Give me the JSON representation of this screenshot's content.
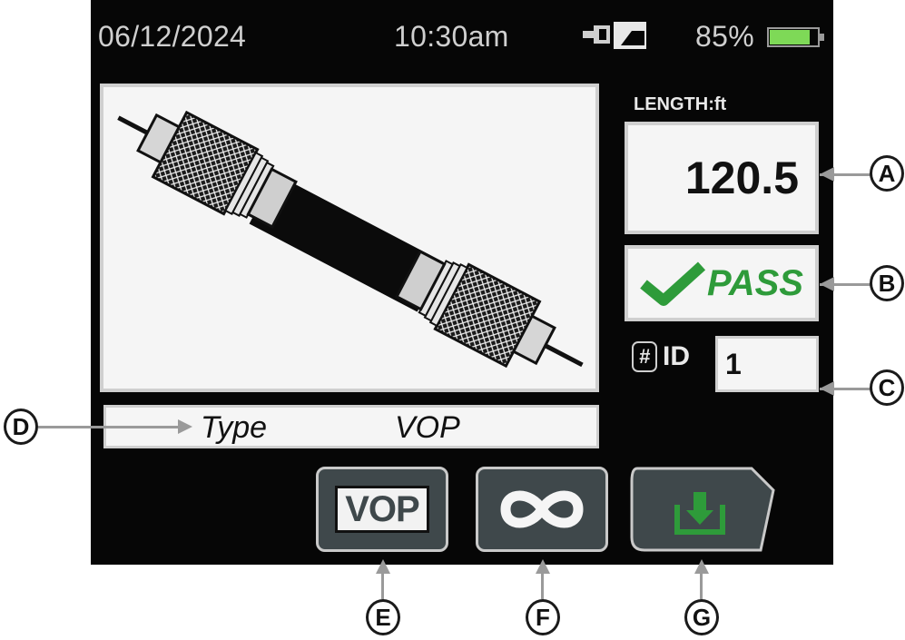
{
  "status_bar": {
    "date": "06/12/2024",
    "time": "10:30am",
    "battery_percent": "85%",
    "battery_level": 0.85,
    "connection_icon": "connector-icon"
  },
  "length": {
    "label": "LENGTH:ft",
    "value": "120.5"
  },
  "result": {
    "text": "PASS",
    "icon": "checkmark-icon",
    "color": "#2e9b3a"
  },
  "id_field": {
    "hash": "#",
    "label": "ID",
    "value": "1"
  },
  "info_bar": {
    "type_label": "Type",
    "vop_label": "VOP"
  },
  "softkeys": {
    "vop_label": "VOP",
    "loop_icon": "infinity-icon",
    "save_icon": "download-icon"
  },
  "callouts": {
    "a": "A",
    "b": "B",
    "c": "C",
    "d": "D",
    "e": "E",
    "f": "F",
    "g": "G"
  },
  "colors": {
    "screen_bg": "#060606",
    "pass_green": "#2e9b3a",
    "battery_green": "#7ed957",
    "softkey_bg": "#3f484b"
  }
}
